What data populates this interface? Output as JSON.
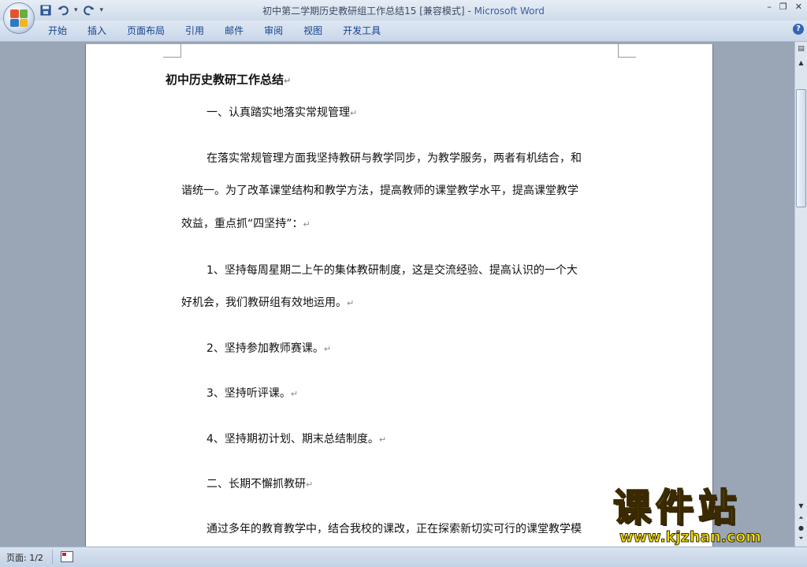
{
  "window": {
    "doc_title": "初中第二学期历史教研组工作总结15 [兼容模式]",
    "separator": " - ",
    "app_name": "Microsoft Word",
    "min_symbol": "–",
    "restore_symbol": "❐",
    "close_symbol": "✕"
  },
  "ribbon": {
    "tabs": [
      "开始",
      "插入",
      "页面布局",
      "引用",
      "邮件",
      "审阅",
      "视图",
      "开发工具"
    ],
    "help_symbol": "?"
  },
  "document": {
    "paragraph_mark": "↵",
    "lines": [
      "初中历史教研工作总结",
      "一、认真踏实地落实常规管理",
      "在落实常规管理方面我坚持教研与教学同步，为教学服务，两者有机结合，和",
      "谐统一。为了改革课堂结构和教学方法，提高教师的课堂教学水平，提高课堂教学",
      "效益，重点抓“四坚持”：",
      "1、坚持每周星期二上午的集体教研制度，这是交流经验、提高认识的一个大",
      "好机会，我们教研组有效地运用。",
      "2、坚持参加教师赛课。",
      "3、坚持听评课。",
      "4、坚持期初计划、期末总结制度。",
      "二、长期不懈抓教研",
      "通过多年的教育教学中，结合我校的课改，正在探索新切实可行的课堂教学模"
    ]
  },
  "statusbar": {
    "page_info": "页面: 1/2"
  },
  "watermark": {
    "main": "课件站",
    "url": "www.kjzhan.com"
  },
  "colors": {
    "workspace_bg": "#9aa6b6",
    "ribbon_text": "#15428b",
    "title_app": "#3a5fa0",
    "watermark_yellow": "#f3e300"
  }
}
